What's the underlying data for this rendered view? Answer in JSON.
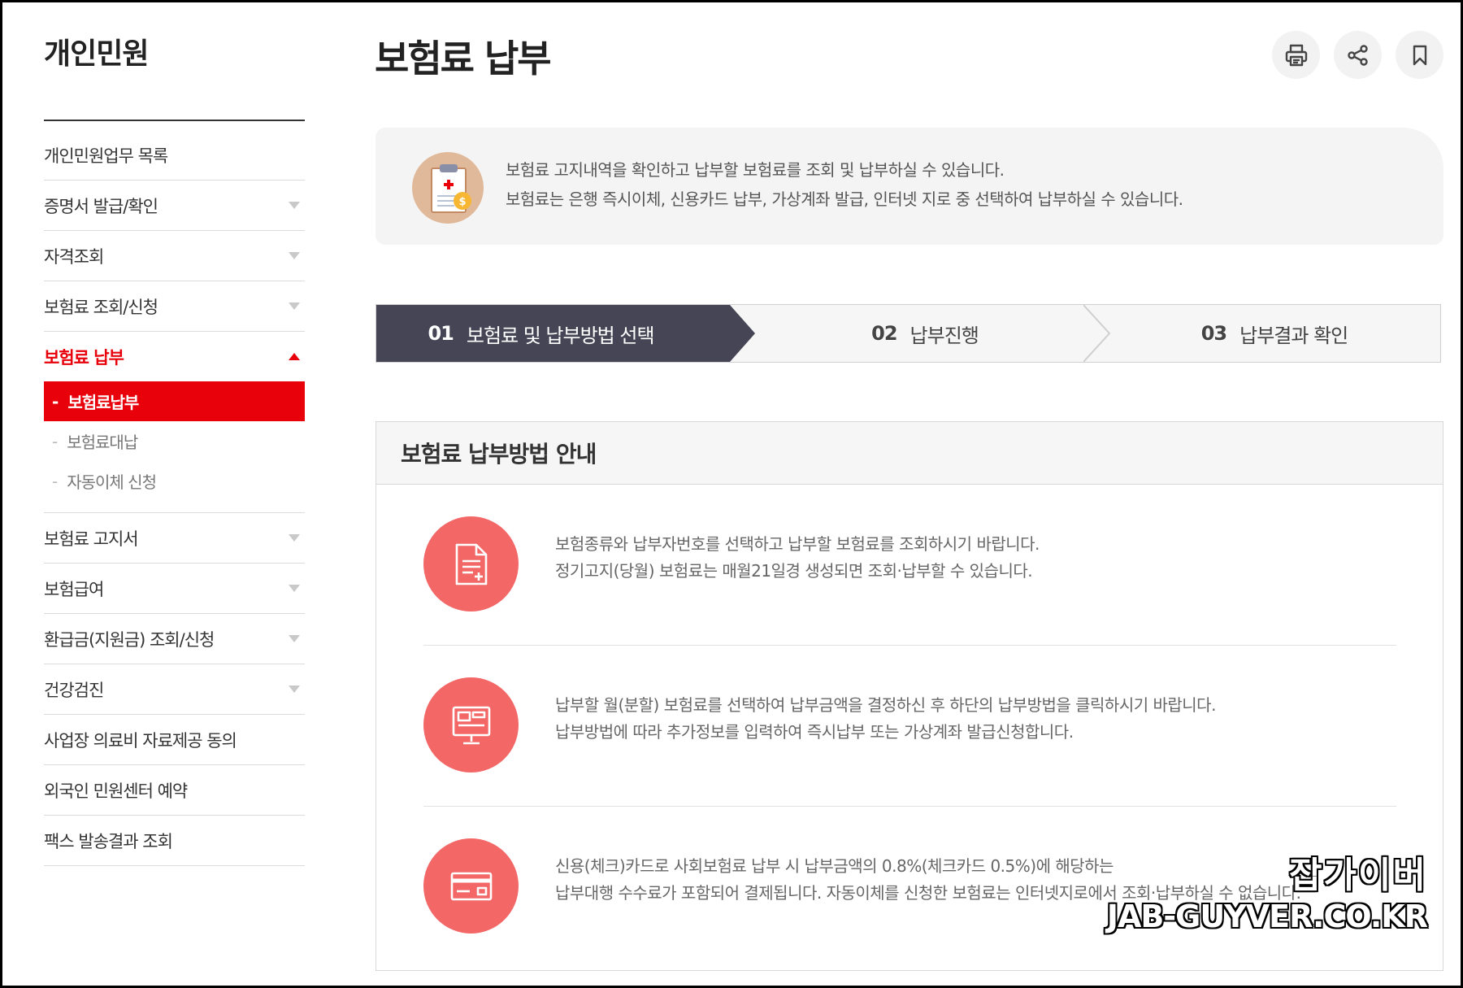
{
  "sidebar": {
    "title": "개인민원",
    "items": [
      {
        "label": "개인민원업무 목록",
        "has_arrow": false
      },
      {
        "label": "증명서 발급/확인",
        "has_arrow": true
      },
      {
        "label": "자격조회",
        "has_arrow": true
      },
      {
        "label": "보험료 조회/신청",
        "has_arrow": true
      },
      {
        "label": "보험료 납부",
        "has_arrow": true,
        "active": true
      },
      {
        "label": "보험료 고지서",
        "has_arrow": true
      },
      {
        "label": "보험급여",
        "has_arrow": true
      },
      {
        "label": "환급금(지원금) 조회/신청",
        "has_arrow": true
      },
      {
        "label": "건강검진",
        "has_arrow": true
      },
      {
        "label": "사업장 의료비 자료제공 동의",
        "has_arrow": false
      },
      {
        "label": "외국인 민원센터 예약",
        "has_arrow": false
      },
      {
        "label": "팩스 발송결과 조회",
        "has_arrow": false
      }
    ],
    "submenu": [
      {
        "label": "보험료납부",
        "active": true
      },
      {
        "label": "보험료대납"
      },
      {
        "label": "자동이체 신청"
      }
    ],
    "dash": "-"
  },
  "header": {
    "title": "보험료 납부",
    "tools": [
      "print-icon",
      "share-icon",
      "bookmark-icon"
    ]
  },
  "intro": {
    "line1": "보험료 고지내역을 확인하고 납부할 보험료를 조회 및 납부하실 수 있습니다.",
    "line2": "보험료는 은행 즉시이체, 신용카드 납부, 가상계좌 발급, 인터넷 지로 중 선택하여 납부하실 수 있습니다."
  },
  "steps": [
    {
      "num": "01",
      "label": "보험료 및 납부방법 선택"
    },
    {
      "num": "02",
      "label": "납부진행"
    },
    {
      "num": "03",
      "label": "납부결과 확인"
    }
  ],
  "guide": {
    "title": "보험료 납부방법 안내",
    "rows": [
      {
        "icon": "document-icon",
        "line1": "보험종류와 납부자번호를 선택하고 납부할 보험료를 조회하시기 바랍니다.",
        "line2": "정기고지(당월) 보험료는 매월21일경 생성되면 조회·납부할 수 있습니다."
      },
      {
        "icon": "monitor-icon",
        "line1": "납부할 월(분할) 보험료를 선택하여 납부금액을 결정하신 후 하단의 납부방법을 클릭하시기 바랍니다.",
        "line2": "납부방법에 따라 추가정보를 입력하여 즉시납부 또는 가상계좌 발급신청합니다."
      },
      {
        "icon": "card-icon",
        "line1": "신용(체크)카드로 사회보험료 납부 시 납부금액의 0.8%(체크카드 0.5%)에 해당하는",
        "line2": "납부대행 수수료가 포함되어 결제됩니다. 자동이체를 신청한 보험료는 인터넷지로에서 조회·납부하실 수 없습니다."
      }
    ]
  },
  "watermark": {
    "korean": "잡가이버",
    "english": "JAB-GUYVER.CO.KR"
  },
  "colors": {
    "accent": "#e8000b",
    "step_active": "#454556",
    "icon_bg": "#f36767"
  }
}
